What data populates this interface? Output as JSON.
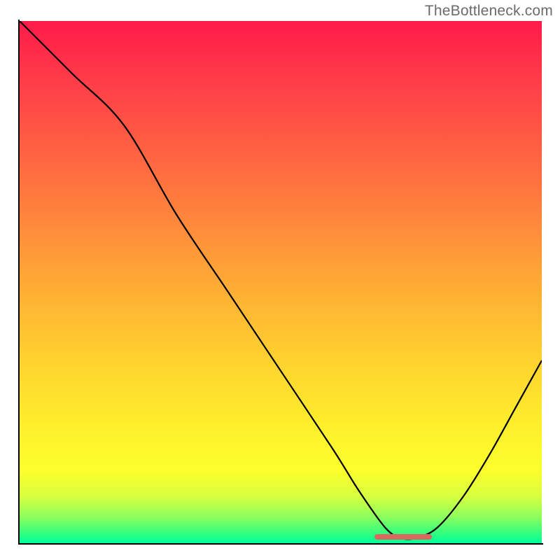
{
  "watermark": "TheBottleneck.com",
  "chart_data": {
    "type": "line",
    "title": "",
    "xlabel": "",
    "ylabel": "",
    "xlim": [
      0,
      100
    ],
    "ylim": [
      0,
      100
    ],
    "grid": false,
    "legend": false,
    "background": "gradient-red-to-green-vertical",
    "series": [
      {
        "name": "bottleneck-curve",
        "x": [
          0,
          10,
          20,
          30,
          40,
          50,
          60,
          65,
          70,
          73,
          76,
          80,
          85,
          90,
          95,
          100
        ],
        "y": [
          100,
          90,
          80,
          63,
          48,
          33,
          18,
          10,
          3,
          1,
          1,
          3,
          9,
          17,
          26,
          35
        ],
        "color": "#000000"
      }
    ],
    "annotations": [
      {
        "type": "marker-band",
        "x_start": 68,
        "x_end": 79,
        "y": 1.2,
        "color": "#d9695f"
      }
    ],
    "gradient_stops": [
      {
        "pos": 0,
        "color": "#ff1a4a"
      },
      {
        "pos": 50,
        "color": "#ffb833"
      },
      {
        "pos": 80,
        "color": "#fcff2c"
      },
      {
        "pos": 100,
        "color": "#00ff9c"
      }
    ]
  }
}
